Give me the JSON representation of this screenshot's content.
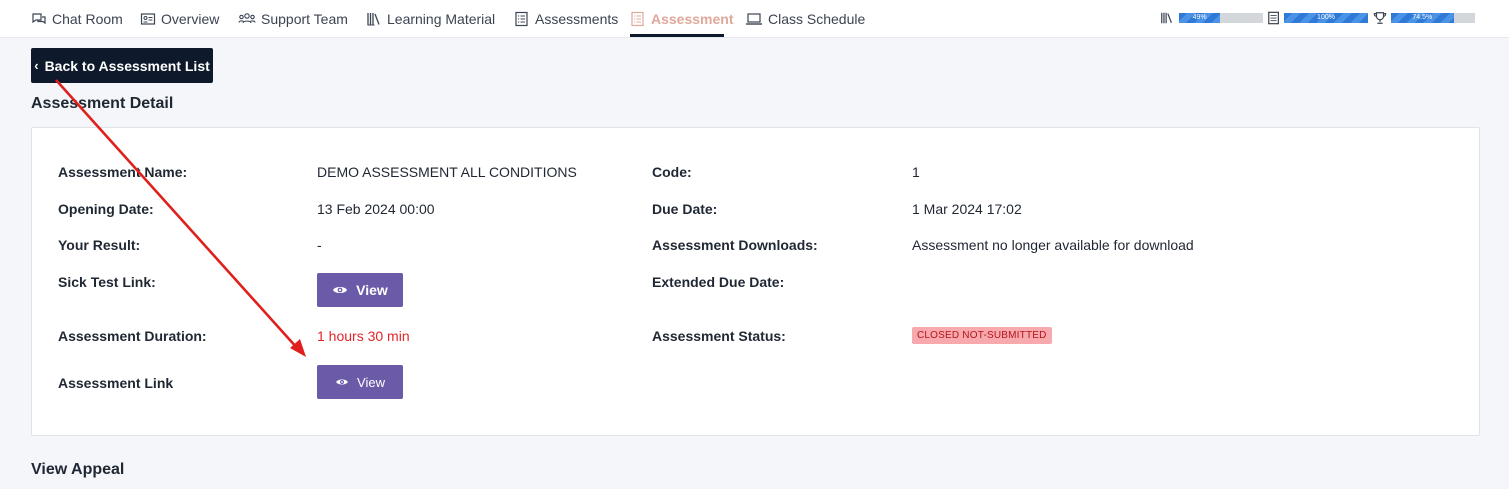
{
  "nav": {
    "tabs": [
      {
        "label": "Chat Room",
        "icon": "chat-icon"
      },
      {
        "label": "Overview",
        "icon": "id-card-icon"
      },
      {
        "label": "Support Team",
        "icon": "team-icon"
      },
      {
        "label": "Learning Material",
        "icon": "books-icon"
      },
      {
        "label": "Assessments",
        "icon": "list-icon"
      },
      {
        "label": "Assessment",
        "icon": "list-icon",
        "active": true
      },
      {
        "label": "Class Schedule",
        "icon": "laptop-icon"
      }
    ]
  },
  "progress": [
    {
      "icon": "books-icon",
      "label": "49%",
      "value": 0.49
    },
    {
      "icon": "list-icon",
      "label": "100%",
      "value": 1.0
    },
    {
      "icon": "trophy-icon",
      "label": "74.5%",
      "value": 0.745
    }
  ],
  "back_button": {
    "label": "Back to Assessment List"
  },
  "detail_title": "Assessment Detail",
  "details": {
    "assessment_name_label": "Assessment Name:",
    "assessment_name_value": "DEMO ASSESSMENT ALL CONDITIONS",
    "code_label": "Code:",
    "code_value": "1",
    "opening_date_label": "Opening Date:",
    "opening_date_value": "13 Feb 2024 00:00",
    "due_date_label": "Due Date:",
    "due_date_value": "1 Mar 2024 17:02",
    "your_result_label": "Your Result:",
    "your_result_value": "-",
    "downloads_label": "Assessment Downloads:",
    "downloads_value": "Assessment no longer available for download",
    "sick_test_label": "Sick Test Link:",
    "sick_test_button": "View",
    "extended_due_label": "Extended Due Date:",
    "duration_label": "Assessment Duration:",
    "duration_value": "1 hours 30 min",
    "status_label": "Assessment Status:",
    "status_value": "CLOSED NOT-SUBMITTED",
    "link_label": "Assessment Link",
    "link_button": "View"
  },
  "appeal_title": "View Appeal",
  "colors": {
    "nav_active": "#e0a89b",
    "back_button_bg": "#0e1a2b",
    "view_button_bg": "#6b5aa7",
    "duration_red": "#e3262a",
    "status_badge_bg": "#f7a9ad",
    "annotation_arrow": "#e0201c"
  }
}
